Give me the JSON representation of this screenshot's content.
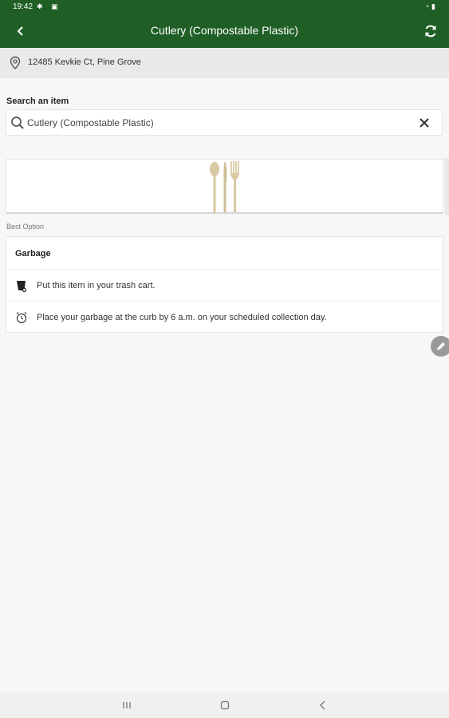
{
  "status": {
    "time": "19:42",
    "left_icons": "✱ ▣",
    "right_icons": "◔▮"
  },
  "header": {
    "title": "Cutlery (Compostable Plastic)",
    "background": "#1f5f26"
  },
  "address": {
    "text": "12485 Kevkie Ct, Pine Grove"
  },
  "search": {
    "label": "Search an item",
    "value": "Cutlery (Compostable Plastic)"
  },
  "result": {
    "section_label": "Best Option",
    "title": "Garbage",
    "rows": [
      {
        "icon": "trash-cart-icon",
        "text": "Put this item in your trash cart."
      },
      {
        "icon": "alarm-clock-icon",
        "text": "Place your garbage at the curb by 6 a.m. on your scheduled collection day."
      }
    ]
  },
  "colors": {
    "brand_green": "#1f5f26",
    "cutlery_tan": "#d8c9a3",
    "fab_gray": "#9a9a9a"
  }
}
